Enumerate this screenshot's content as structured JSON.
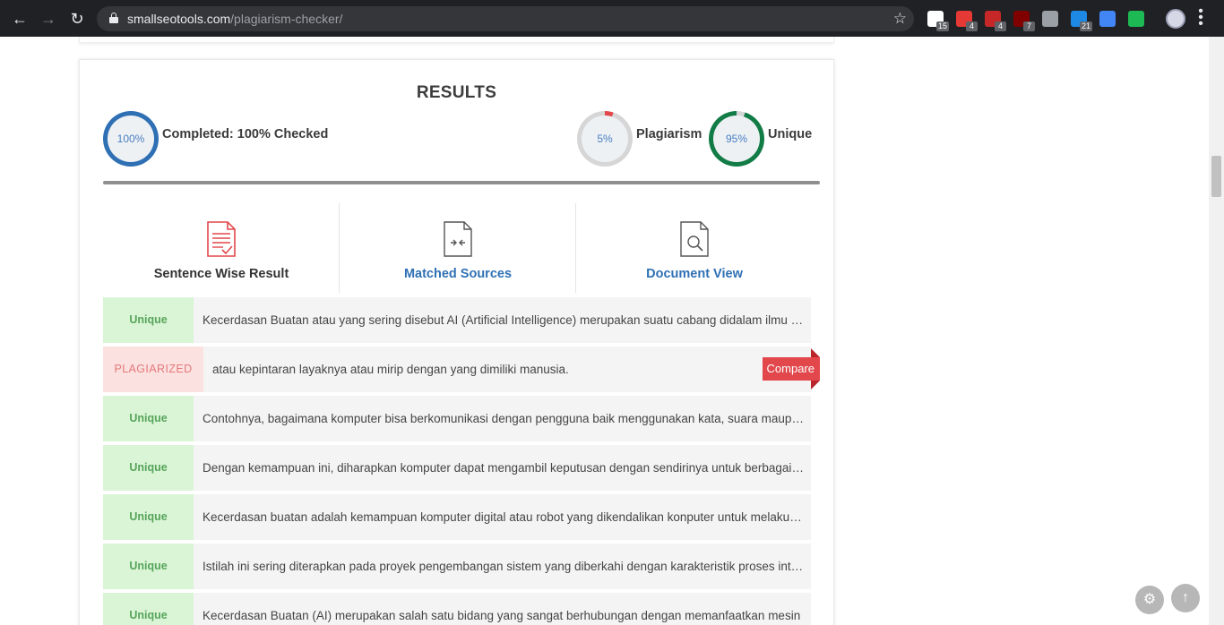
{
  "browser": {
    "url_host": "smallseotools.com",
    "url_path": "/plagiarism-checker/",
    "extensions": [
      {
        "icon": "chat-extension-icon",
        "badge": "15",
        "color": "#ffffff"
      },
      {
        "icon": "red-extension-icon",
        "badge": "4",
        "color": "#e53935"
      },
      {
        "icon": "abp-icon",
        "badge": "4",
        "color": "#c62828"
      },
      {
        "icon": "ublock-icon",
        "badge": "7",
        "color": "#800000"
      },
      {
        "icon": "camera-icon",
        "badge": "",
        "color": "#9aa0a6"
      },
      {
        "icon": "cursor-extension-icon",
        "badge": "21",
        "color": "#1e88e5"
      },
      {
        "icon": "pen-extension-icon",
        "badge": "",
        "color": "#4285f4"
      },
      {
        "icon": "shield-extension-icon",
        "badge": "",
        "color": "#1db954"
      }
    ]
  },
  "results": {
    "title": "RESULTS",
    "completed_value": "100%",
    "completed_label": "Completed: 100% Checked",
    "plagiarism_value": "5%",
    "plagiarism_label": "Plagiarism",
    "plagiarism_percent": 5,
    "unique_value": "95%",
    "unique_label": "Unique",
    "unique_percent": 95
  },
  "tabs": [
    {
      "label": "Sentence Wise Result",
      "icon": "sentence-document-icon",
      "active": true
    },
    {
      "label": "Matched Sources",
      "icon": "compare-document-icon",
      "active": false
    },
    {
      "label": "Document View",
      "icon": "search-document-icon",
      "active": false
    }
  ],
  "compare_label": "Compare",
  "sentences": [
    {
      "status": "Unique",
      "type": "unique",
      "text": "Kecerdasan Buatan atau yang sering disebut AI (Artificial Intelligence) merupakan suatu cabang didalam ilmu komputer yang mempelajari bagaimana membuat mesin memiliki kecerdasan"
    },
    {
      "status": "PLAGIARIZED",
      "type": "plag",
      "text": "atau kepintaran layaknya atau mirip dengan yang dimiliki manusia."
    },
    {
      "status": "Unique",
      "type": "unique",
      "text": "Contohnya, bagaimana komputer bisa berkomunikasi dengan pengguna baik menggunakan kata, suara maupun gambar"
    },
    {
      "status": "Unique",
      "type": "unique",
      "text": "Dengan kemampuan ini, diharapkan komputer dapat mengambil keputusan dengan sendirinya untuk berbagai kasus"
    },
    {
      "status": "Unique",
      "type": "unique",
      "text": "Kecerdasan buatan adalah kemampuan komputer digital atau robot yang dikendalikan konputer untuk melakukan tugas"
    },
    {
      "status": "Unique",
      "type": "unique",
      "text": "Istilah ini sering diterapkan pada proyek pengembangan sistem yang diberkahi dengan karakteristik proses intelektual"
    },
    {
      "status": "Unique",
      "type": "unique",
      "text": "Kecerdasan Buatan (AI) merupakan salah satu bidang yang sangat berhubungan dengan memanfaatkan mesin"
    }
  ],
  "colors": {
    "accent_blue": "#2f70b4",
    "plagiarism_red": "#e2474c",
    "unique_green": "#127c46"
  }
}
